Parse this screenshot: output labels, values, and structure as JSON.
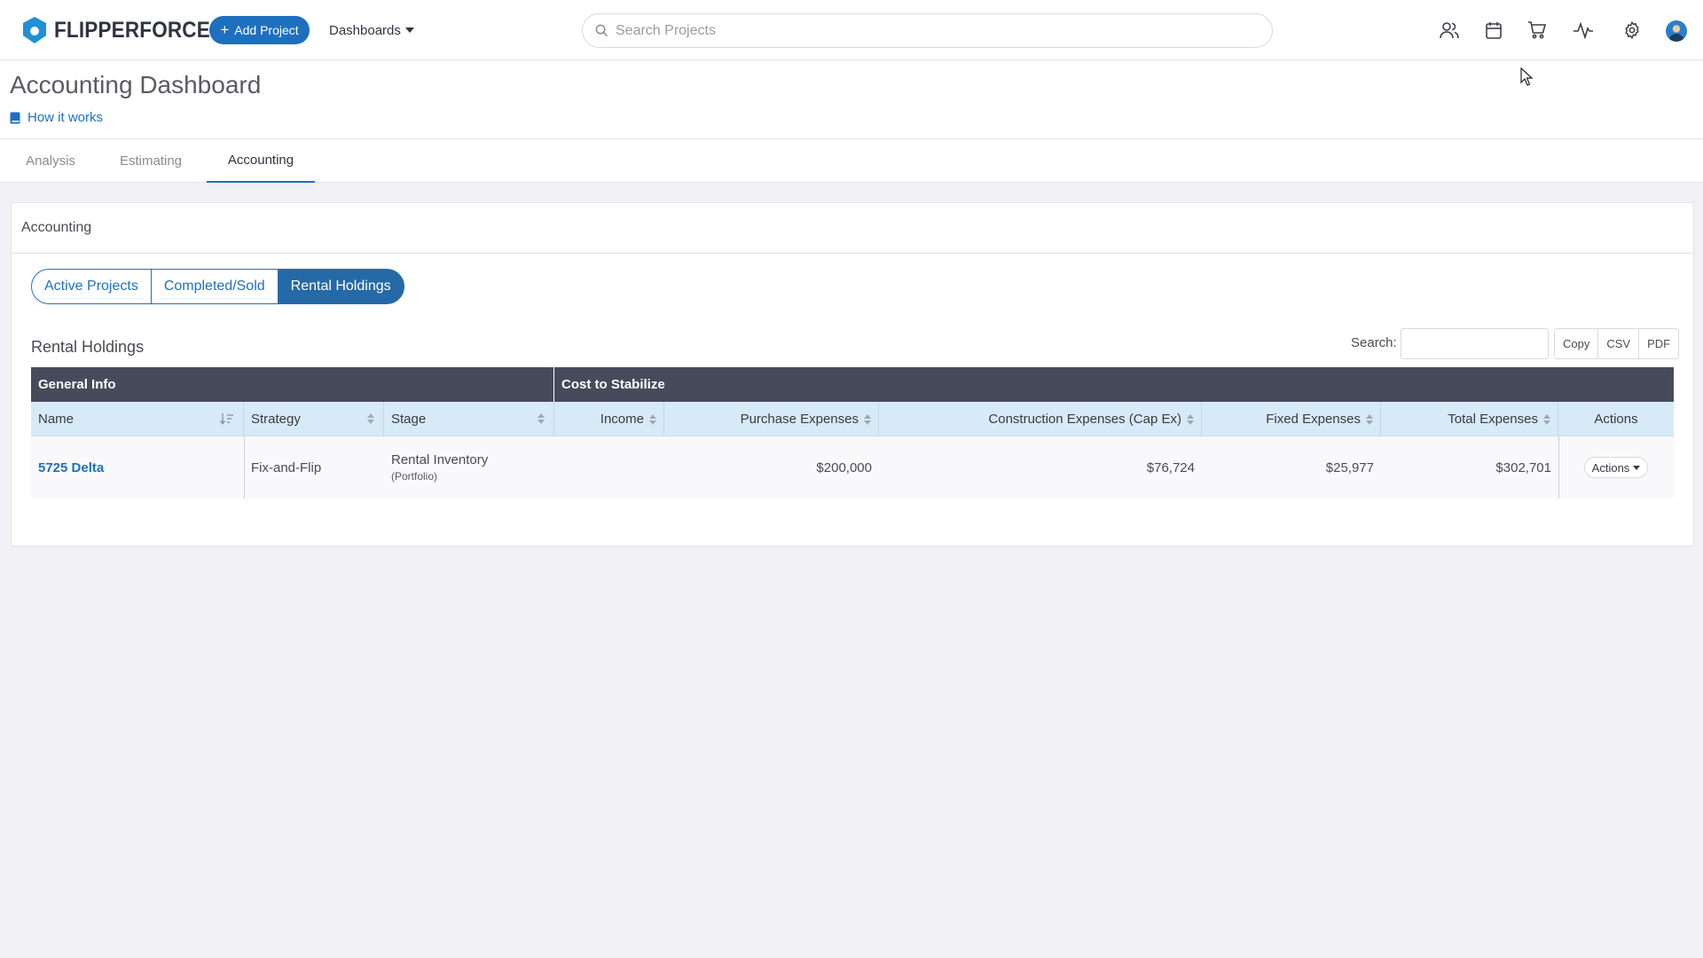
{
  "app": {
    "brand": "FLIPPERFORCE",
    "add_project_label": "Add Project",
    "dashboards_label": "Dashboards",
    "search_placeholder": "Search Projects",
    "brand_color": "#1f6fbf",
    "nav_icons": [
      "users-icon",
      "calendar-icon",
      "cart-icon",
      "activity-icon",
      "gear-icon",
      "avatar-icon"
    ]
  },
  "page": {
    "title": "Accounting Dashboard",
    "help_link": "How it works"
  },
  "tabs": [
    {
      "label": "Analysis",
      "active": false
    },
    {
      "label": "Estimating",
      "active": false
    },
    {
      "label": "Accounting",
      "active": true
    }
  ],
  "card": {
    "title": "Accounting",
    "segments": [
      {
        "label": "Active Projects",
        "active": false
      },
      {
        "label": "Completed/Sold",
        "active": false
      },
      {
        "label": "Rental Holdings",
        "active": true
      }
    ],
    "section_title": "Rental Holdings",
    "search_label": "Search:",
    "export_buttons": [
      "Copy",
      "CSV",
      "PDF"
    ]
  },
  "table": {
    "groups": [
      "General Info",
      "Cost to Stabilize"
    ],
    "columns": [
      "Name",
      "Strategy",
      "Stage",
      "Income",
      "Purchase Expenses",
      "Construction Expenses (Cap Ex)",
      "Fixed Expenses",
      "Total Expenses",
      "Actions"
    ],
    "rows": [
      {
        "name": "5725 Delta",
        "strategy": "Fix-and-Flip",
        "stage": "Rental Inventory",
        "stage_sub": "(Portfolio)",
        "income": "",
        "purchase_expenses": "$200,000",
        "construction_expenses": "$76,724",
        "fixed_expenses": "$25,977",
        "total_expenses": "$302,701",
        "actions_label": "Actions"
      }
    ]
  }
}
